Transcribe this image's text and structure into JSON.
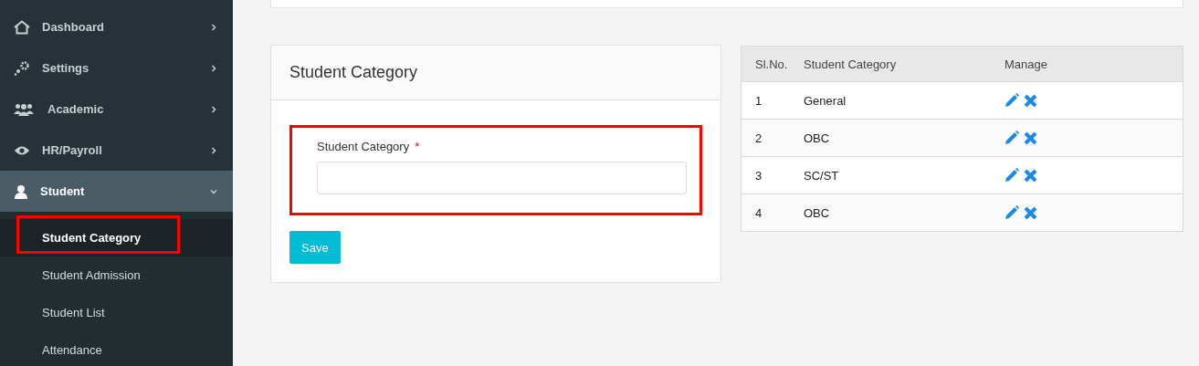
{
  "sidebar": {
    "items": [
      {
        "label": "Dashboard",
        "expanded": false,
        "selected": false
      },
      {
        "label": "Settings",
        "expanded": false,
        "selected": false
      },
      {
        "label": "Academic",
        "expanded": false,
        "selected": false
      },
      {
        "label": "HR/Payroll",
        "expanded": false,
        "selected": false
      },
      {
        "label": "Student",
        "expanded": true,
        "selected": true,
        "children": [
          {
            "label": "Student Category",
            "selected": true,
            "highlighted": true
          },
          {
            "label": "Student Admission",
            "selected": false,
            "highlighted": false
          },
          {
            "label": "Student List",
            "selected": false,
            "highlighted": false
          },
          {
            "label": "Attendance",
            "selected": false,
            "highlighted": false
          }
        ]
      }
    ]
  },
  "form_card": {
    "title": "Student Category",
    "field": {
      "label": "Student Category",
      "required_mark": "*",
      "highlighted": true
    },
    "button": "Save"
  },
  "table": {
    "columns": [
      "Sl.No.",
      "Student Category",
      "Manage"
    ],
    "rows": [
      {
        "number": "1",
        "category": "General"
      },
      {
        "number": "2",
        "category": "OBC"
      },
      {
        "number": "3",
        "category": "SC/ST"
      },
      {
        "number": "4",
        "category": "OBC"
      }
    ]
  }
}
